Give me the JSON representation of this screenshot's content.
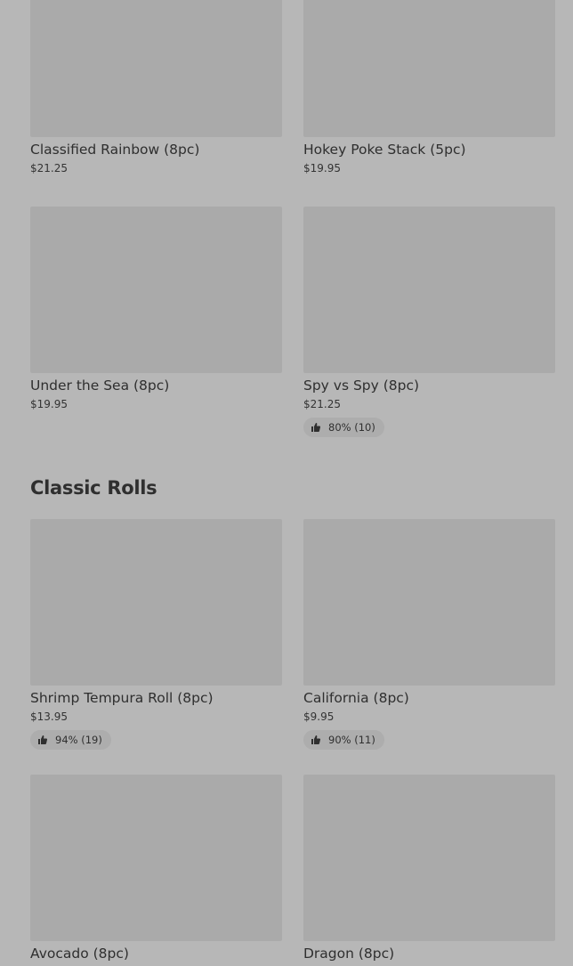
{
  "top_items": [
    {
      "name": "Classified Rainbow (8pc)",
      "price": "$21.25"
    },
    {
      "name": "Hokey Poke Stack (5pc)",
      "price": "$19.95"
    },
    {
      "name": "Under the Sea (8pc)",
      "price": "$19.95"
    },
    {
      "name": "Spy vs Spy (8pc)",
      "price": "$21.25",
      "rating": "80% (10)"
    }
  ],
  "classic": {
    "title": "Classic Rolls",
    "items": [
      {
        "name": "Shrimp Tempura Roll  (8pc)",
        "price": "$13.95",
        "rating": "94% (19)"
      },
      {
        "name": "California (8pc)",
        "price": "$9.95",
        "rating": "90% (11)"
      },
      {
        "name": "Avocado (8pc)",
        "price": ""
      },
      {
        "name": "Dragon (8pc)",
        "price": ""
      }
    ]
  },
  "colors": {
    "background": "#b7b7b7",
    "image_placeholder": "#aaaaaa",
    "rating_pill": "#adadad"
  },
  "icons": {
    "rating": "thumbs-up-icon"
  }
}
